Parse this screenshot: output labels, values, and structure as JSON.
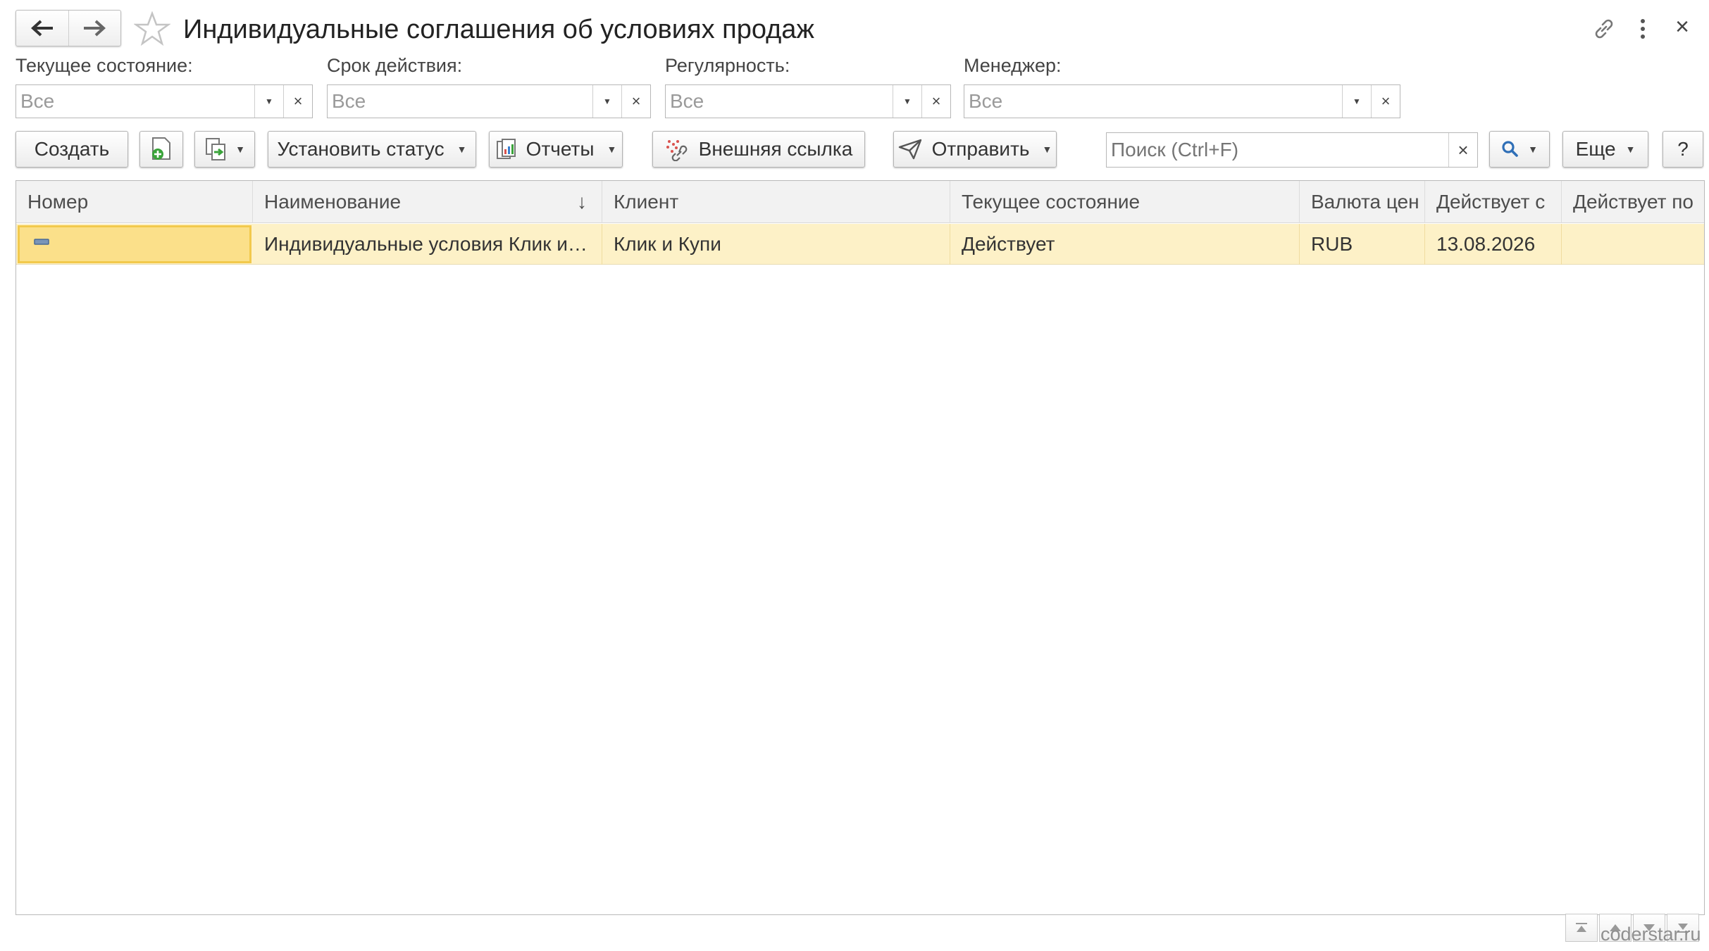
{
  "window": {
    "title": "Индивидуальные соглашения об условиях продаж",
    "back_icon": "arrow-left-icon",
    "forward_icon": "arrow-right-icon",
    "favorite_icon": "star-icon",
    "link_icon": "link-icon",
    "menu_icon": "more-vertical-icon",
    "close_label": "×"
  },
  "filters": [
    {
      "label": "Текущее состояние:",
      "value": "Все"
    },
    {
      "label": "Срок действия:",
      "value": "Все"
    },
    {
      "label": "Регулярность:",
      "value": "Все"
    },
    {
      "label": "Менеджер:",
      "value": "Все"
    }
  ],
  "toolbar": {
    "create_label": "Создать",
    "set_status_label": "Установить статус",
    "reports_label": "Отчеты",
    "external_link_label": "Внешняя ссылка",
    "send_label": "Отправить",
    "search_placeholder": "Поиск (Ctrl+F)",
    "search_clear_label": "×",
    "more_label": "Еще",
    "help_label": "?"
  },
  "table": {
    "columns": [
      "Номер",
      "Наименование",
      "Клиент",
      "Текущее состояние",
      "Валюта цен",
      "Действует с",
      "Действует по"
    ],
    "sort_indicator": "↓",
    "rows": [
      {
        "number": "",
        "name": "Индивидуальные условия Клик и Купи",
        "client": "Клик и Купи",
        "state": "Действует",
        "currency": "RUB",
        "valid_from": "13.08.2026",
        "valid_to": ""
      }
    ]
  },
  "watermark": "coderstar.ru",
  "colors": {
    "selected_row": "#fdf1c7",
    "selected_cell_border": "#f2c94c",
    "selected_cell_bg": "#fbe08a"
  }
}
